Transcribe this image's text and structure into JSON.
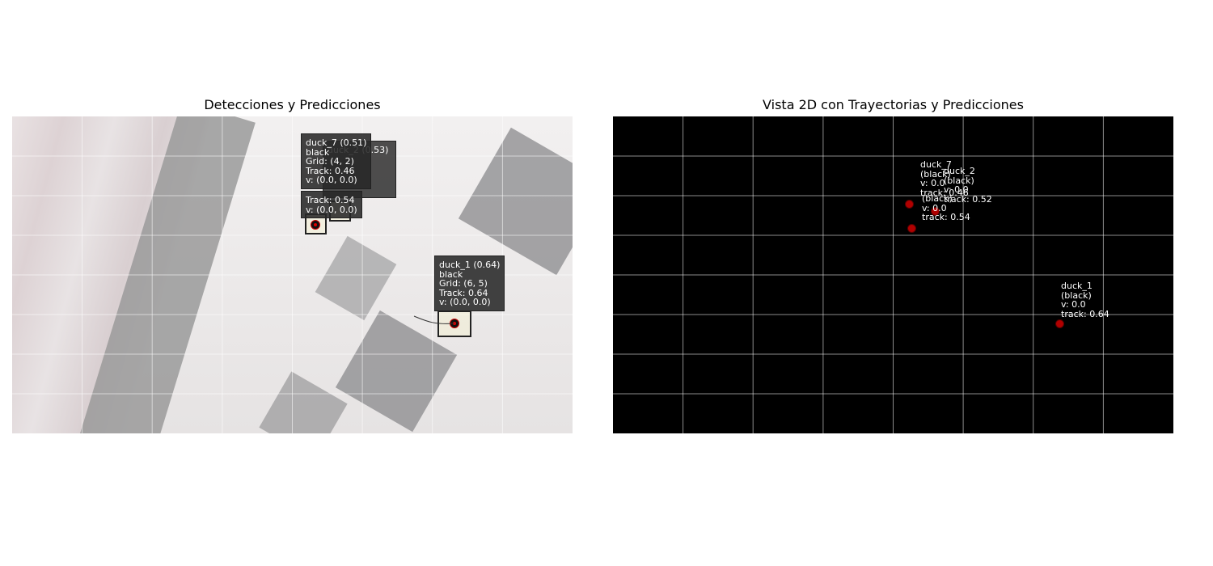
{
  "left_panel": {
    "title": "Detecciones y Predicciones",
    "detections": [
      {
        "label": "duck_7 (0.51)\nblack\nGrid: (4, 2)\nTrack: 0.46\nv: (0.0, 0.0)"
      },
      {
        "label": "duck_2 (0.53)"
      },
      {
        "label": "Track: 0.54\nv: (0.0, 0.0)"
      },
      {
        "label": "duck_1 (0.64)\nblack\nGrid: (6, 5)\nTrack: 0.64\nv: (0.0, 0.0)"
      }
    ]
  },
  "right_panel": {
    "title": "Vista 2D con Trayectorias y Predicciones",
    "tracks": [
      {
        "label": "duck_7\n(black)\nv: 0.0\ntrack: 0.46"
      },
      {
        "label": "duck_2\n(black)\nv: 0.0\ntrack: 0.52"
      },
      {
        "label": "(black)\nv: 0.0\ntrack: 0.54"
      },
      {
        "label": "duck_1\n(black)\nv: 0.0\ntrack: 0.64"
      }
    ]
  },
  "colors": {
    "map_background": "#000000",
    "marker": "#b00000",
    "label_box": "#282828"
  }
}
